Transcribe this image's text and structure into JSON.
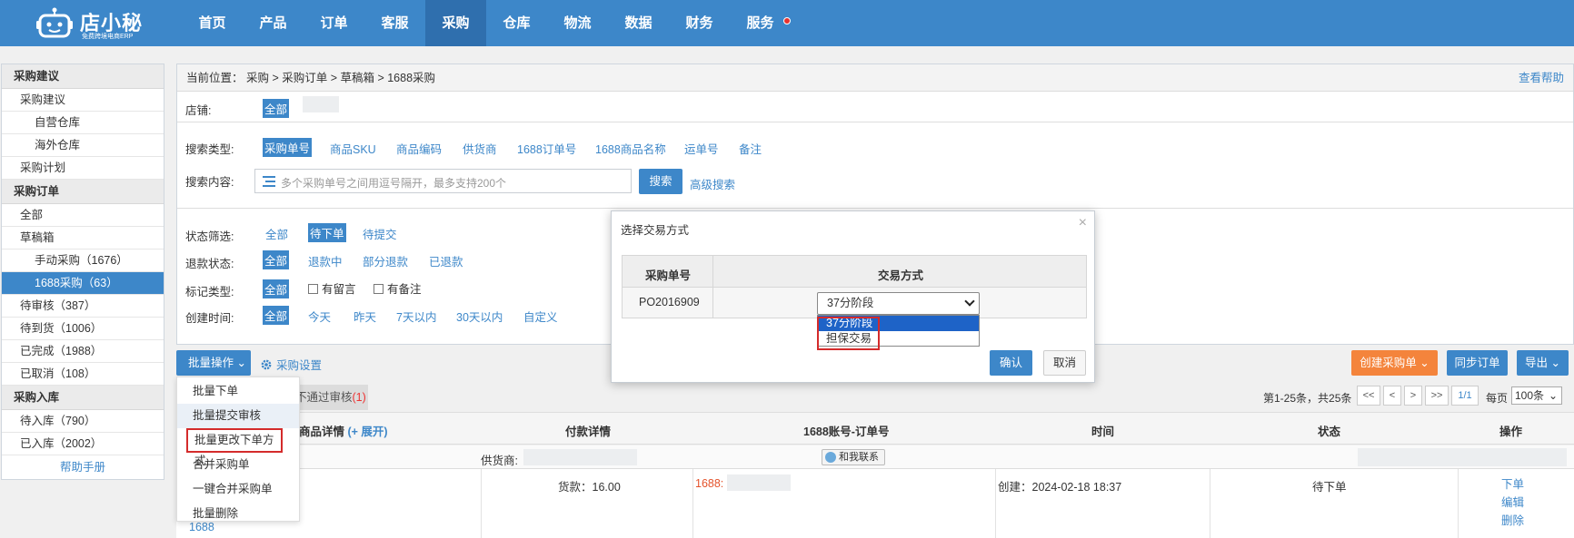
{
  "brand": {
    "name": "店小秘",
    "subtitle": "免费跨境电商ERP"
  },
  "nav": [
    "首页",
    "产品",
    "订单",
    "客服",
    "采购",
    "仓库",
    "物流",
    "数据",
    "财务",
    "服务"
  ],
  "nav_active": "采购",
  "sidebar": {
    "section1": "采购建议",
    "item_suggest": "采购建议",
    "item_self_wh": "自营仓库",
    "item_overseas_wh": "海外仓库",
    "item_plan": "采购计划",
    "section2": "采购订单",
    "item_all": "全部",
    "item_draft": "草稿箱",
    "item_manual": "手动采购（1676）",
    "item_1688": "1688采购（63）",
    "item_pending_review": "待审核（387）",
    "item_pending_arrival": "待到货（1006）",
    "item_done": "已完成（1988）",
    "item_cancelled": "已取消（108）",
    "section3": "采购入库",
    "item_pending_in": "待入库（790）",
    "item_in": "已入库（2002）",
    "help": "帮助手册"
  },
  "breadcrumb": "当前位置：   采购 > 采购订单 > 草稿箱 > 1688采购",
  "help_link": "查看帮助",
  "filters": {
    "shop_label": "店铺:",
    "shop_all": "全部",
    "search_type_label": "搜索类型:",
    "search_types": [
      "采购单号",
      "商品SKU",
      "商品编码",
      "供货商",
      "1688订单号",
      "1688商品名称",
      "运单号",
      "备注"
    ],
    "search_content_label": "搜索内容:",
    "search_placeholder": "多个采购单号之间用逗号隔开，最多支持200个",
    "search_button": "搜索",
    "advanced_search": "高级搜索",
    "status_label": "状态筛选:",
    "status_options": [
      "全部",
      "待下单",
      "待提交"
    ],
    "refund_label": "退款状态:",
    "refund_options": [
      "全部",
      "退款中",
      "部分退款",
      "已退款"
    ],
    "mark_label": "标记类型:",
    "mark_options": [
      "全部",
      "有留言",
      "有备注"
    ],
    "time_label": "创建时间:",
    "time_options": [
      "全部",
      "今天",
      "昨天",
      "7天以内",
      "30天以内",
      "自定义"
    ]
  },
  "toolbar": {
    "batch_label": "批量操作",
    "settings_label": "采购设置",
    "create_label": "创建采购单",
    "sync_label": "同步订单",
    "export_label": "导出"
  },
  "batch_menu": [
    "批量下单",
    "批量提交审核",
    "批量更改下单方式",
    "合并采购单",
    "一键合并采购单",
    "批量删除"
  ],
  "tab_review": {
    "text": "不通过审核",
    "count": "(1)"
  },
  "pagination": {
    "summary": "第1-25条，共25条",
    "first": "<<",
    "prev": "<",
    "next": ">",
    "last": ">>",
    "page": "1/1",
    "per_page_label": "每页",
    "per_page": "100条"
  },
  "table": {
    "headers": {
      "product": "商品详情",
      "expand": "(+ 展开)",
      "payment": "付款详情",
      "account": "1688账号-订单号",
      "time": "时间",
      "status": "状态",
      "ops": "操作"
    },
    "supplier_label": "供货商:",
    "contact_label": "和我联系",
    "row": {
      "product_text": "1688",
      "payment": "货款：16.00",
      "account": "1688:",
      "time": "创建：2024-02-18 18:37",
      "status": "待下单",
      "ops": [
        "下单",
        "编辑",
        "删除"
      ]
    }
  },
  "modal": {
    "title": "选择交易方式",
    "close": "×",
    "col_order": "采购单号",
    "col_method": "交易方式",
    "order_no": "PO2016909",
    "selected": "37分阶段",
    "options": [
      "37分阶段",
      "担保交易"
    ],
    "confirm": "确认",
    "cancel": "取消"
  },
  "colors": {
    "primary": "#3d87c9",
    "orange": "#f4843c",
    "highlight": "#d42b2b"
  }
}
